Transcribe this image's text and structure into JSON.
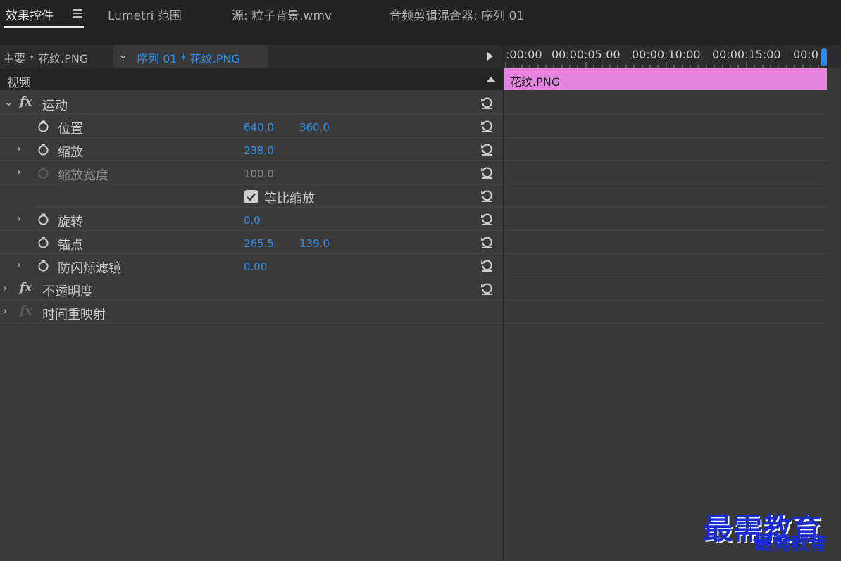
{
  "tabs": [
    {
      "label": "效果控件",
      "active": true
    },
    {
      "label": "Lumetri 范围",
      "active": false
    },
    {
      "label": "源: 粒子背景.wmv",
      "active": false
    },
    {
      "label": "音频剪辑混合器: 序列 01",
      "active": false
    }
  ],
  "clip_bar": {
    "master": "主要 * 花纹.PNG",
    "sequence": "序列 01 * 花纹.PNG"
  },
  "section": {
    "label": "视频"
  },
  "rows": {
    "motion": {
      "label": "运动"
    },
    "position": {
      "label": "位置",
      "x": "640.0",
      "y": "360.0"
    },
    "scale": {
      "label": "缩放",
      "value": "238.0"
    },
    "scale_width": {
      "label": "缩放宽度",
      "value": "100.0"
    },
    "uniform_scale": {
      "label": "等比缩放",
      "checked": true
    },
    "rotation": {
      "label": "旋转",
      "value": "0.0"
    },
    "anchor": {
      "label": "锚点",
      "x": "265.5",
      "y": "139.0"
    },
    "anti_flicker": {
      "label": "防闪烁滤镜",
      "value": "0.00"
    },
    "opacity": {
      "label": "不透明度"
    },
    "time_remap": {
      "label": "时间重映射"
    }
  },
  "timeline": {
    "timecodes": [
      ":00:00",
      "00:00:05:00",
      "00:00:10:00",
      "00:00:15:00",
      "00:0"
    ],
    "clip_name": "花纹.PNG"
  },
  "watermark": {
    "text": "最需教育"
  },
  "colors": {
    "accent": "#2d8ceb",
    "clip": "#e384e0",
    "panel": "#3a3a3a",
    "watermark": "#1a2bd0"
  }
}
